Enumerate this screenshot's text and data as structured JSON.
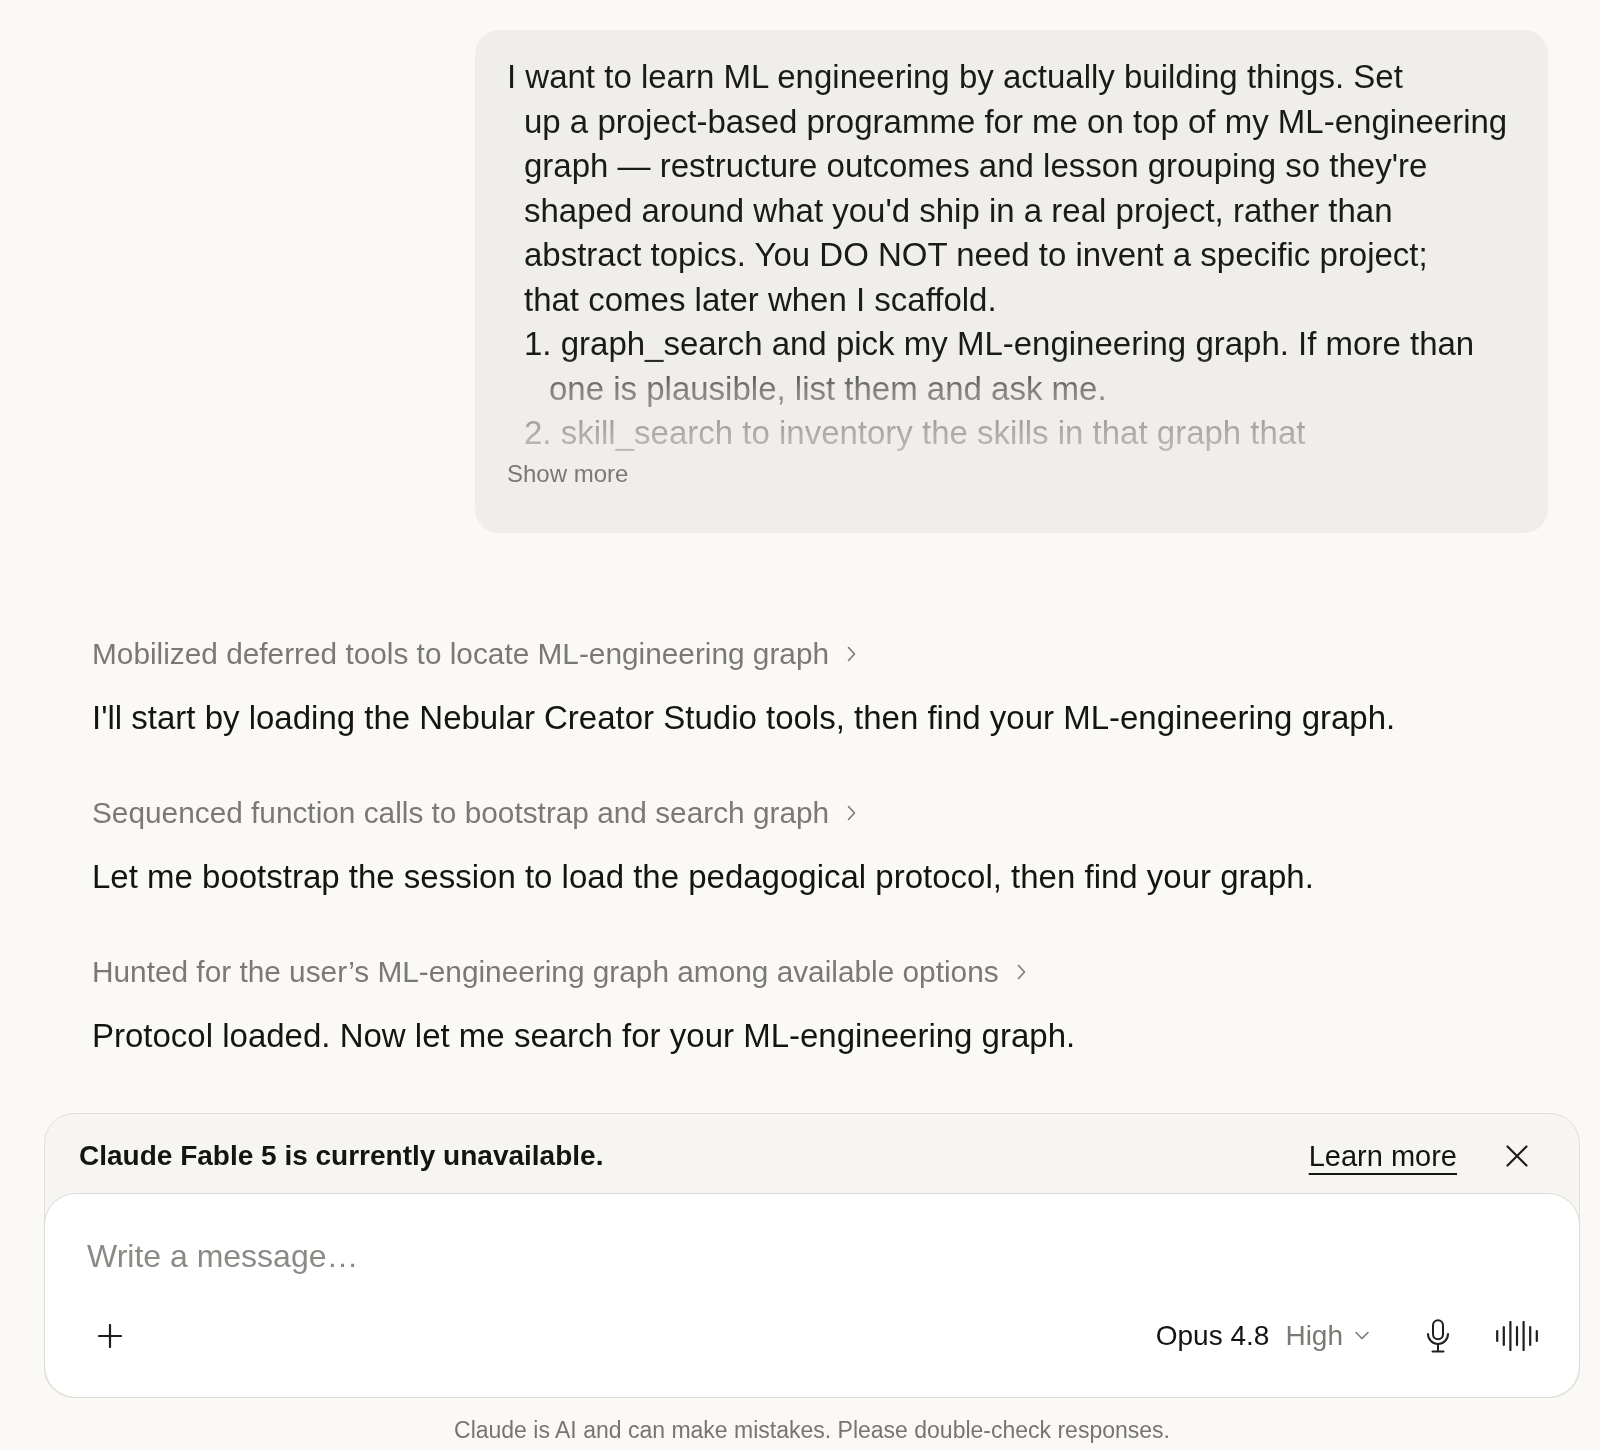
{
  "user_message": {
    "intro": "I want to learn ML engineering by actually building things. Set\nup a project-based programme for me on top of my ML-engineering\ngraph — restructure outcomes and lesson grouping so they're\nshaped around what you'd ship in a real project, rather than\nabstract topics. You DO NOT need to invent a specific project;\nthat comes later when I scaffold.",
    "list_items": [
      "1. graph_search and pick my ML-engineering graph. If more than\none is plausible, list them and ask me.",
      "2. skill_search to inventory the skills in that graph that"
    ],
    "show_more": "Show more"
  },
  "assistant": {
    "steps": [
      {
        "summary": "Mobilized deferred tools to locate ML-engineering graph",
        "expanded": false,
        "reply": "I'll start by loading the Nebular Creator Studio tools, then find your ML-engineering graph."
      },
      {
        "summary": "Sequenced function calls to bootstrap and search graph",
        "expanded": false,
        "reply": "Let me bootstrap the session to load the pedagogical protocol, then find your graph."
      },
      {
        "summary": "Hunted for the user’s ML-engineering graph among available options",
        "expanded": false,
        "reply": "Protocol loaded. Now let me search for your ML-engineering graph."
      }
    ]
  },
  "notice": {
    "message": "Claude Fable 5 is currently unavailable.",
    "link": "Learn more"
  },
  "composer": {
    "placeholder": "Write a message…",
    "model": "Opus 4.8",
    "effort": "High"
  },
  "disclaimer": "Claude is AI and can make mistakes. Please double-check responses."
}
